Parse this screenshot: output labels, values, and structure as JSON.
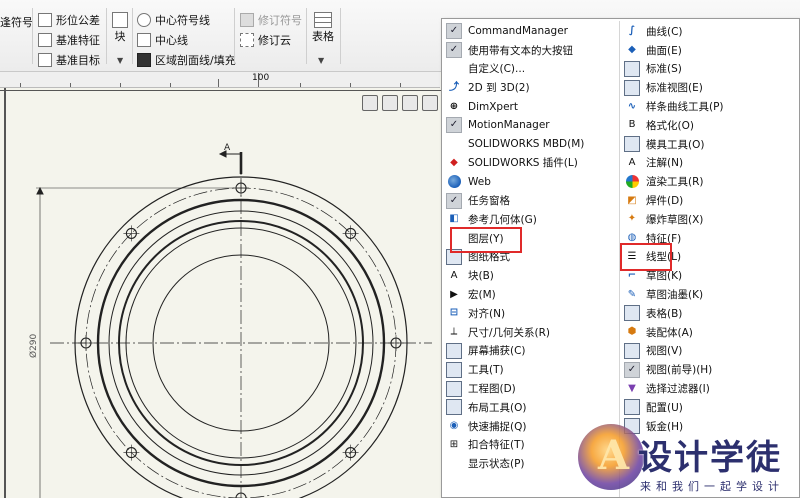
{
  "toolbar": {
    "items": {
      "datum_symbol": "逢符号",
      "gtol": "形位公差",
      "datum_feature": "基准特征",
      "datum_target": "基准目标",
      "block": "块",
      "centerline_symbol": "中心符号线",
      "centerline": "中心线",
      "area_hatch": "区域剖面线/填充",
      "revision_symbol": "修订符号",
      "revision_cloud": "修订云",
      "table": "表格"
    }
  },
  "ruler": {
    "label": "100"
  },
  "drawing": {
    "section_label": "A",
    "dimension_label": "Ø290"
  },
  "menu": {
    "left": [
      {
        "label": "CommandManager",
        "icon": "check",
        "checked": true
      },
      {
        "label": "使用带有文本的大按钮",
        "icon": "check",
        "checked": true
      },
      {
        "label": "自定义(C)...",
        "icon": "blank"
      },
      {
        "label": "2D 到 3D(2)",
        "icon": "2d-to-3d-icon"
      },
      {
        "label": "DimXpert",
        "icon": "dimxpert-icon"
      },
      {
        "label": "MotionManager",
        "icon": "check",
        "checked": true
      },
      {
        "label": "SOLIDWORKS MBD(M)",
        "icon": "blank"
      },
      {
        "label": "SOLIDWORKS 插件(L)",
        "icon": "addins-icon"
      },
      {
        "label": "Web",
        "icon": "web-icon"
      },
      {
        "label": "任务窗格",
        "icon": "check",
        "checked": true
      },
      {
        "label": "参考几何体(G)",
        "icon": "reference-geometry-icon"
      },
      {
        "label": "图层(Y)",
        "icon": "blank"
      },
      {
        "label": "图纸格式",
        "icon": "sheet-format-icon"
      },
      {
        "label": "块(B)",
        "icon": "block-icon"
      },
      {
        "label": "宏(M)",
        "icon": "macro-icon"
      },
      {
        "label": "对齐(N)",
        "icon": "align-icon"
      },
      {
        "label": "尺寸/几何关系(R)",
        "icon": "dimension-icon"
      },
      {
        "label": "屏幕捕获(C)",
        "icon": "screen-capture-icon"
      },
      {
        "label": "工具(T)",
        "icon": "tools-icon"
      },
      {
        "label": "工程图(D)",
        "icon": "drawing-icon"
      },
      {
        "label": "布局工具(O)",
        "icon": "layout-tools-icon"
      },
      {
        "label": "快速捕捉(Q)",
        "icon": "quick-snap-icon"
      },
      {
        "label": "扣合特征(T)",
        "icon": "fastening-features-icon"
      },
      {
        "label": "显示状态(P)",
        "icon": "blank"
      }
    ],
    "right": [
      {
        "label": "曲线(C)",
        "icon": "curves-icon"
      },
      {
        "label": "曲面(E)",
        "icon": "surfaces-icon"
      },
      {
        "label": "标准(S)",
        "icon": "standard-icon"
      },
      {
        "label": "标准视图(E)",
        "icon": "standard-views-icon"
      },
      {
        "label": "样条曲线工具(P)",
        "icon": "spline-tools-icon"
      },
      {
        "label": "格式化(O)",
        "icon": "format-icon"
      },
      {
        "label": "模具工具(O)",
        "icon": "mold-tools-icon"
      },
      {
        "label": "注解(N)",
        "icon": "annotation-icon"
      },
      {
        "label": "渲染工具(R)",
        "icon": "render-tools-icon"
      },
      {
        "label": "焊件(D)",
        "icon": "weldments-icon"
      },
      {
        "label": "爆炸草图(X)",
        "icon": "explode-sketch-icon"
      },
      {
        "label": "特征(F)",
        "icon": "features-icon"
      },
      {
        "label": "线型(L)",
        "icon": "line-format-icon"
      },
      {
        "label": "草图(K)",
        "icon": "sketch-icon"
      },
      {
        "label": "草图油墨(K)",
        "icon": "sketch-ink-icon"
      },
      {
        "label": "表格(B)",
        "icon": "table-icon"
      },
      {
        "label": "装配体(A)",
        "icon": "assembly-icon"
      },
      {
        "label": "视图(V)",
        "icon": "view-icon"
      },
      {
        "label": "视图(前导)(H)",
        "icon": "check",
        "checked": true
      },
      {
        "label": "选择过滤器(I)",
        "icon": "selection-filter-icon"
      },
      {
        "label": "配置(U)",
        "icon": "configurations-icon"
      },
      {
        "label": "钣金(H)",
        "icon": "sheet-metal-icon"
      },
      {
        "label": "",
        "icon": "blank"
      },
      {
        "label": "",
        "icon": "blank"
      }
    ]
  },
  "watermark": {
    "title": "设计学徒",
    "subtitle": "来和我们一起学设计"
  },
  "colors": {
    "highlight": "#e02a2a",
    "menu_bg": "#ffffff",
    "sheet_bg": "#f4f4ec",
    "watermark_text": "#2c2f6e"
  }
}
